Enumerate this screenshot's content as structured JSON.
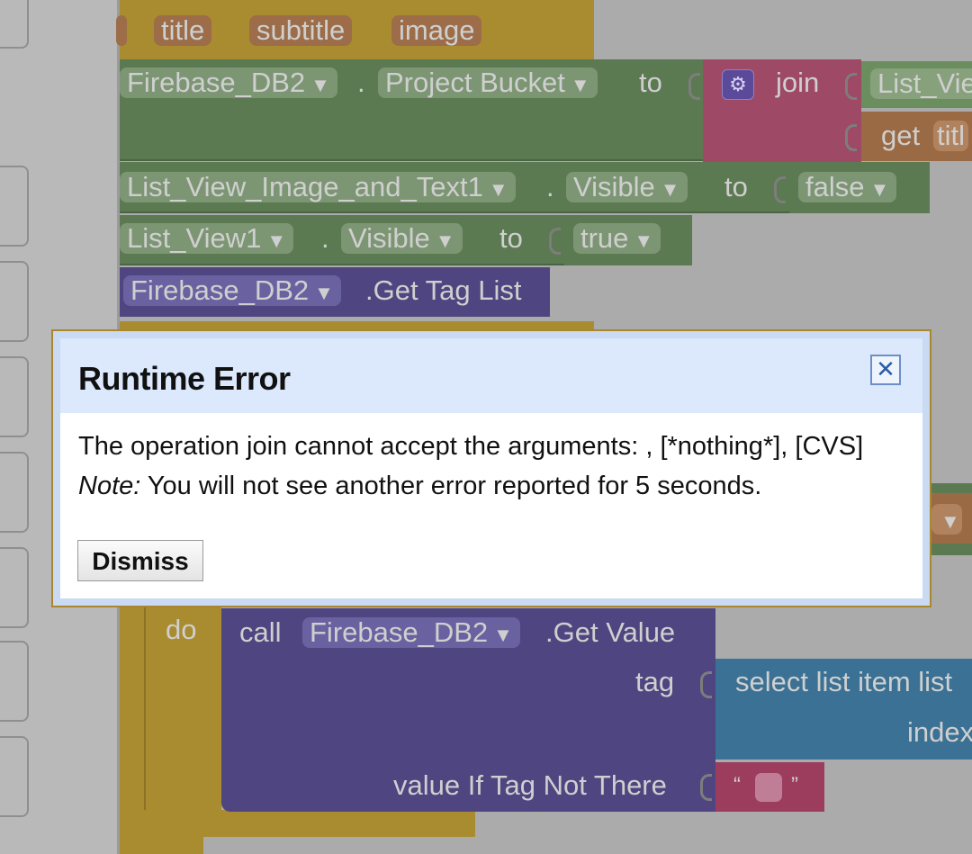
{
  "blocks": {
    "param_chips": [
      "title",
      "subtitle",
      "image"
    ],
    "row_bucket": {
      "component": "Firebase_DB2",
      "dot": ".",
      "property": "Project Bucket",
      "to": "to",
      "join_label": "join",
      "join_arg1": "List_Vie",
      "get_label": "get",
      "get_var": "titl"
    },
    "row_visible1": {
      "component": "List_View_Image_and_Text1",
      "dot": ".",
      "property": "Visible",
      "to": "to",
      "value": "false"
    },
    "row_visible2": {
      "component": "List_View1",
      "dot": ".",
      "property": "Visible",
      "to": "to",
      "value": "true"
    },
    "row_taglist": {
      "component": "Firebase_DB2",
      "method": ".Get Tag List"
    },
    "do_section": {
      "do_label": "do",
      "call_label": "call",
      "component": "Firebase_DB2",
      "method": ".Get Value",
      "tag_label": "tag",
      "select_label": "select list item  list",
      "index_label": "index",
      "value_label": "value If Tag Not There",
      "quote_open": "“",
      "quote_close": "”"
    },
    "dropdown_glyph": "▼"
  },
  "dialog": {
    "title": "Runtime Error",
    "close_glyph": "✕",
    "message": "The operation join cannot accept the arguments: , [*nothing*], [CVS]",
    "note_label": "Note:",
    "note_text": " You will not see another error reported for 5 seconds.",
    "dismiss_label": "Dismiss"
  },
  "colors": {
    "event_orange": "#a98c2f",
    "setter_green": "#5c7a52",
    "text_pink": "#9c3d5d",
    "join_pink": "#9e4a66",
    "get_orange": "#9a6a45",
    "call_purple": "#4f4580",
    "list_blue": "#3a7194",
    "dialog_border": "#a9872f",
    "dialog_header": "#dce8fc"
  }
}
